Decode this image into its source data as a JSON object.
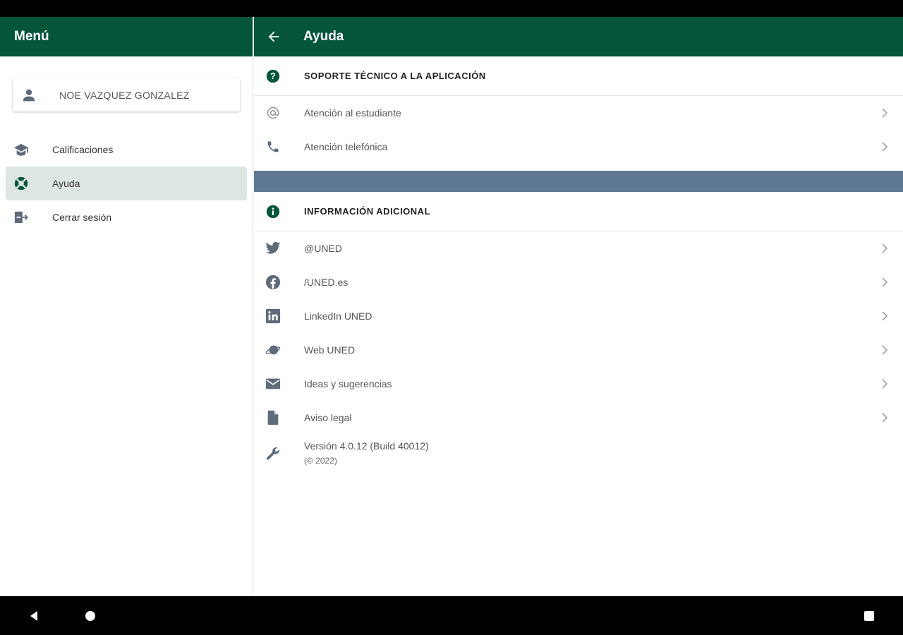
{
  "sidebar": {
    "title": "Menú",
    "user_name": "NOE VAZQUEZ GONZALEZ",
    "items": [
      {
        "label": "Calificaciones",
        "icon": "graduation-cap-icon",
        "active": false
      },
      {
        "label": "Ayuda",
        "icon": "lifebuoy-icon",
        "active": true
      },
      {
        "label": "Cerrar sesión",
        "icon": "logout-icon",
        "active": false
      }
    ]
  },
  "main": {
    "title": "Ayuda",
    "support": {
      "heading": "SOPORTE TÉCNICO A LA APLICACIÓN",
      "items": [
        {
          "label": "Atención al estudiante",
          "icon": "at-icon"
        },
        {
          "label": "Atención telefónica",
          "icon": "phone-icon"
        }
      ]
    },
    "info": {
      "heading": "INFORMACIÓN ADICIONAL",
      "items": [
        {
          "label": "@UNED",
          "icon": "twitter-icon"
        },
        {
          "label": "/UNED.es",
          "icon": "facebook-icon"
        },
        {
          "label": "LinkedIn UNED",
          "icon": "linkedin-icon"
        },
        {
          "label": "Web UNED",
          "icon": "planet-icon"
        },
        {
          "label": "Ideas y sugerencias",
          "icon": "envelope-icon"
        },
        {
          "label": "Aviso legal",
          "icon": "document-icon"
        }
      ],
      "version": "Versión 4.0.12 (Build 40012)",
      "copyright": "(© 2022)"
    }
  },
  "colors": {
    "header": "#04553a",
    "active_item": "#dde6e2",
    "divider_band": "#5d7891",
    "icon_gray": "#5f6b7a"
  }
}
